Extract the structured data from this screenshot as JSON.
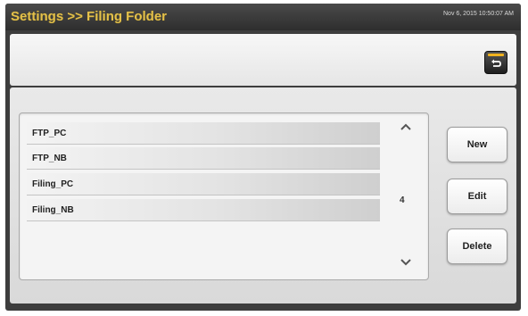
{
  "header": {
    "title": "Settings >> Filing Folder",
    "datetime": "Nov 6, 2015 10:50:07 AM"
  },
  "toolbar": {
    "back_icon": "return-arrow-icon",
    "back_icon_color": "#f0b21e"
  },
  "folder_list": {
    "items": [
      {
        "label": "FTP_PC"
      },
      {
        "label": "FTP_NB"
      },
      {
        "label": "Filing_PC"
      },
      {
        "label": "Filing_NB"
      }
    ],
    "count": "4",
    "scroll_up_icon": "chevron-up-icon",
    "scroll_down_icon": "chevron-down-icon"
  },
  "actions": {
    "new_label": "New",
    "edit_label": "Edit",
    "delete_label": "Delete"
  },
  "colors": {
    "title": "#e3c04a",
    "frame": "#3d3d3d"
  }
}
